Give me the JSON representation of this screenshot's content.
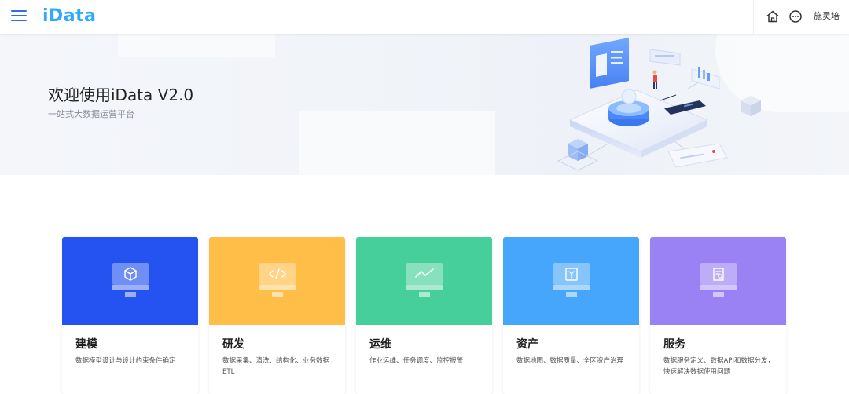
{
  "header": {
    "logo": "iData",
    "username": "施灵培"
  },
  "banner": {
    "title": "欢迎使用iData V2.0",
    "subtitle": "一站式大数据运营平台"
  },
  "cards": [
    {
      "title": "建模",
      "desc": "数据模型设计与设计约束条件确定",
      "color": "#2453f2",
      "icon": "cube-icon"
    },
    {
      "title": "研发",
      "desc": "数据采集、清洗、结构化、业务数据ETL",
      "color": "#ffbe47",
      "icon": "code-icon"
    },
    {
      "title": "运维",
      "desc": "作业运维、任务调度、监控报警",
      "color": "#47cf9b",
      "icon": "trend-icon"
    },
    {
      "title": "资产",
      "desc": "数据地图、数据质量、全区资产治理",
      "color": "#45a6fb",
      "icon": "yen-icon"
    },
    {
      "title": "服务",
      "desc": "数据服务定义、数据API和数据分发，快速解决数据使用问题",
      "color": "#9a82f4",
      "icon": "document-icon"
    }
  ]
}
